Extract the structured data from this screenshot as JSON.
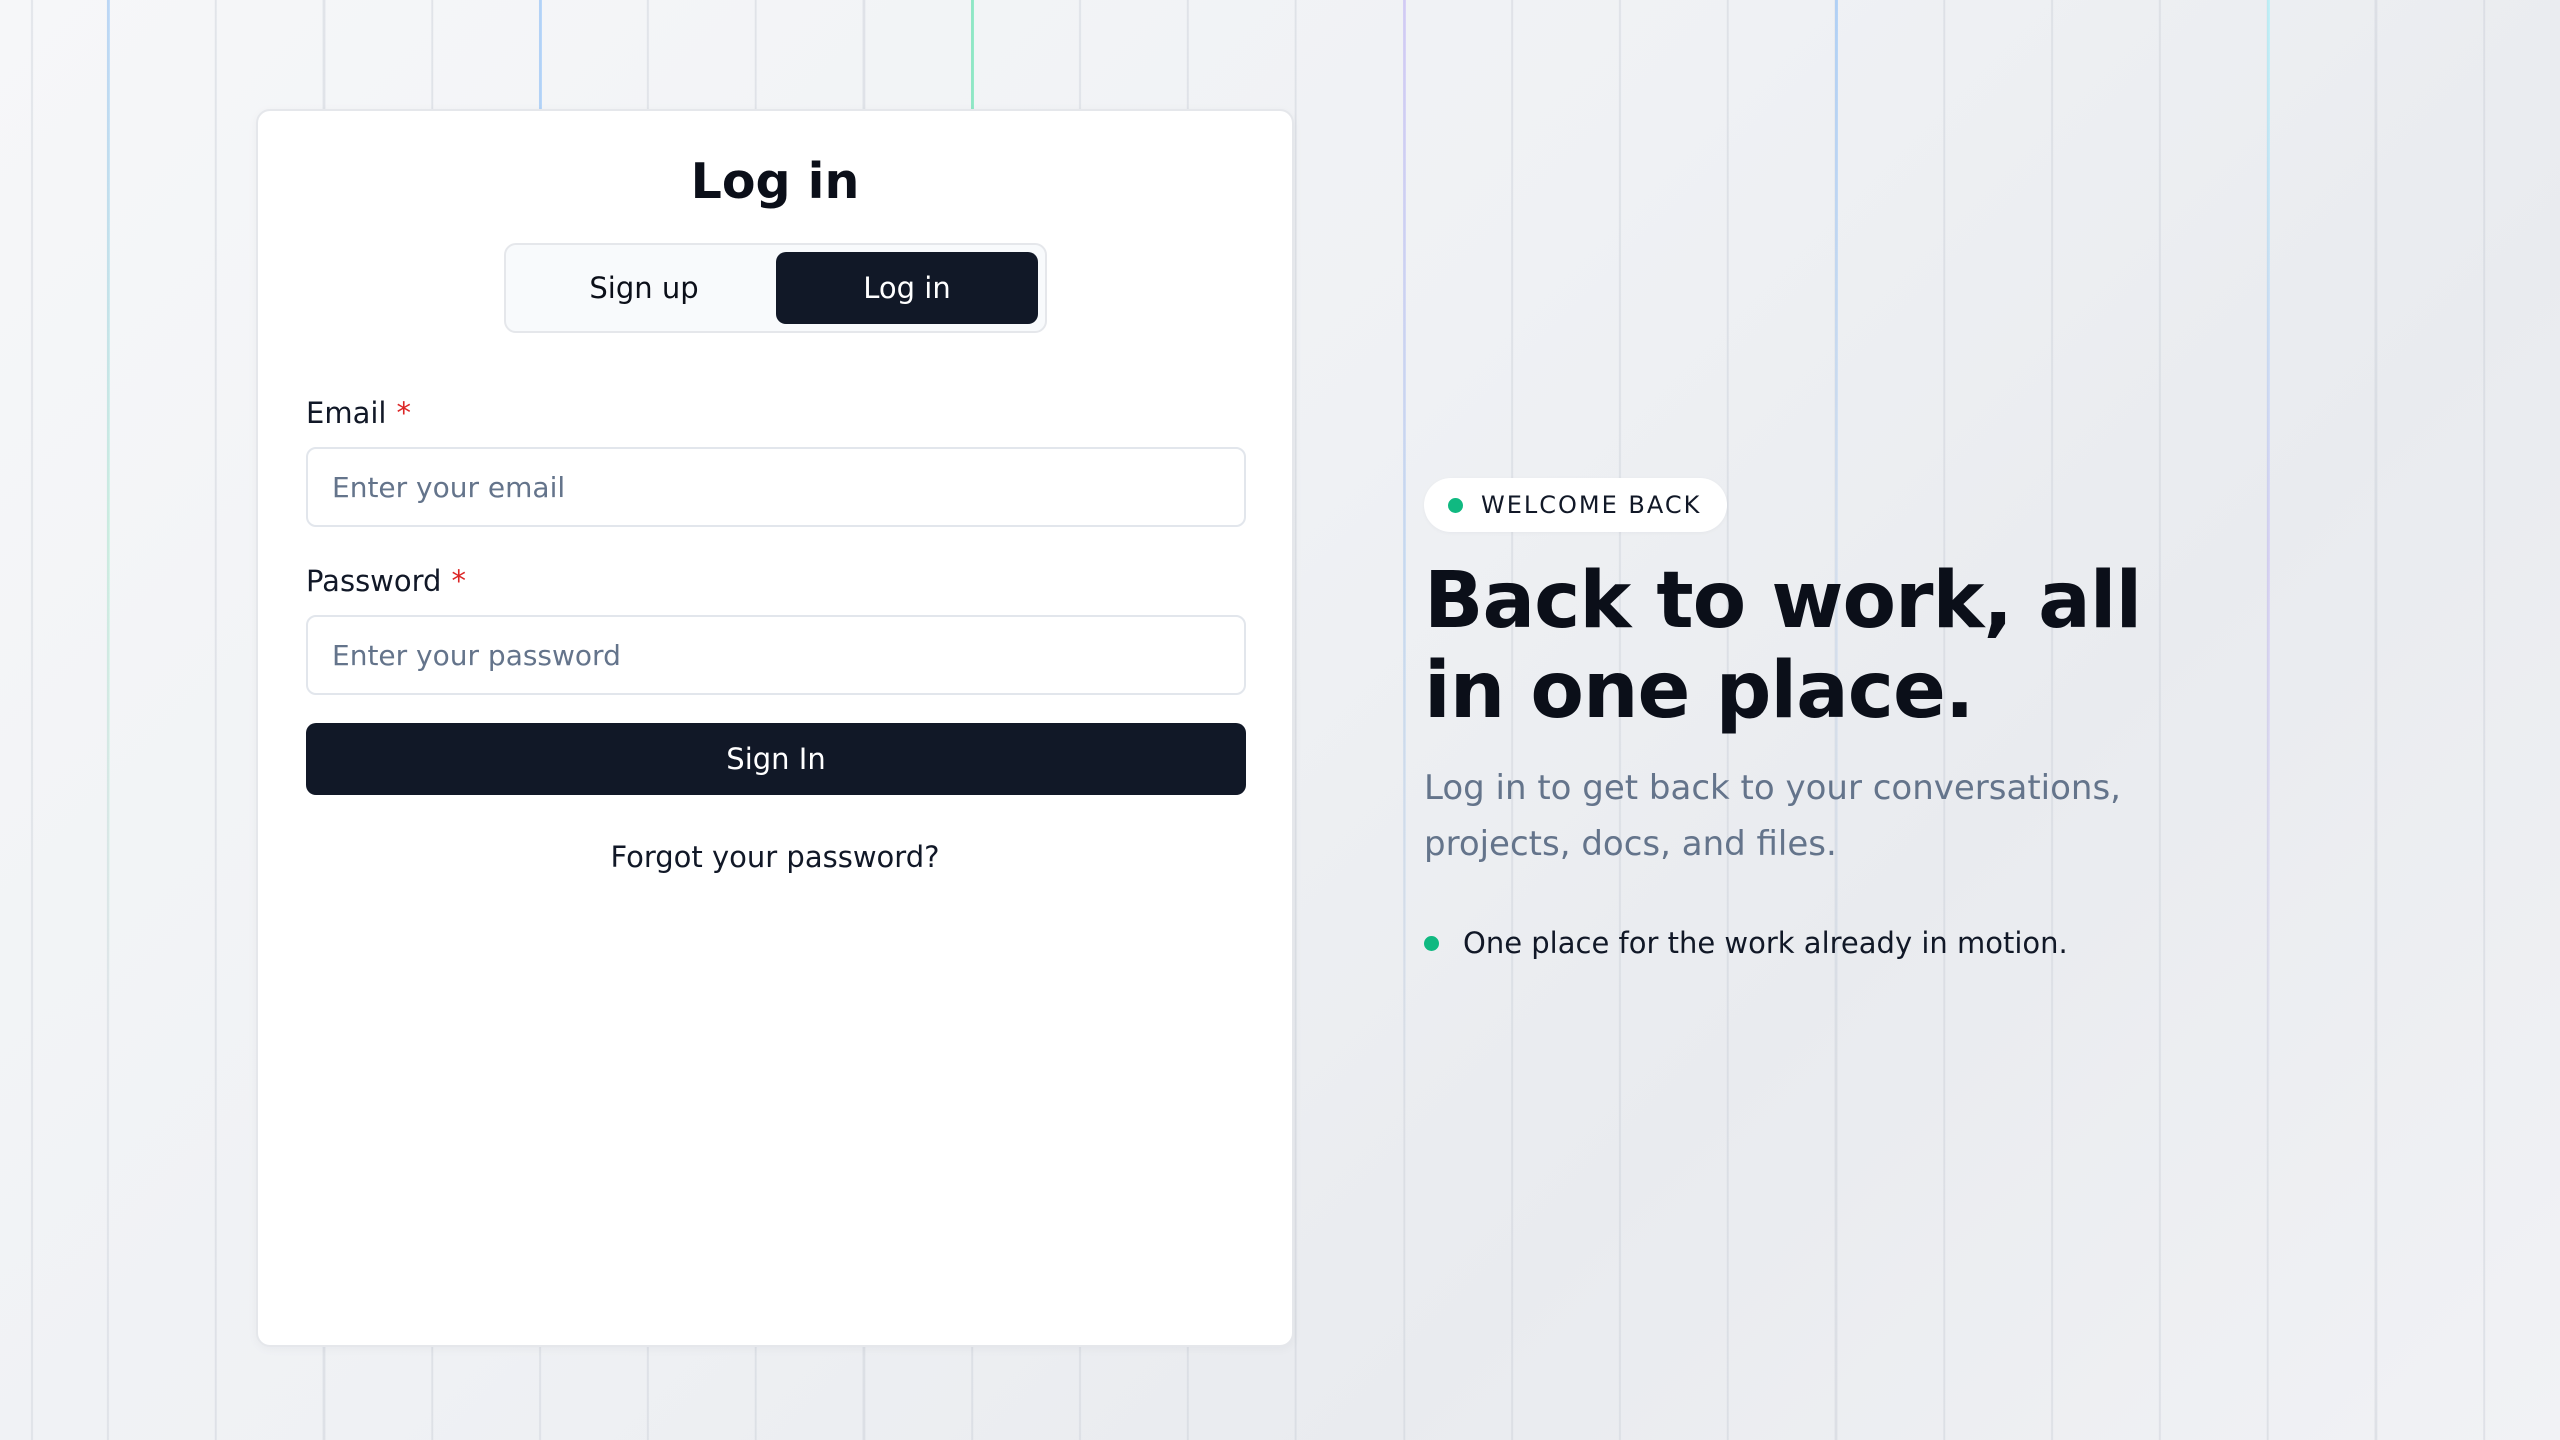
{
  "login_card": {
    "title": "Log in",
    "tabs": [
      {
        "label": "Sign up",
        "active": false
      },
      {
        "label": "Log in",
        "active": true
      }
    ],
    "email": {
      "label": "Email",
      "required_mark": "*",
      "placeholder": "Enter your email",
      "value": ""
    },
    "password": {
      "label": "Password",
      "required_mark": "*",
      "placeholder": "Enter your password",
      "value": ""
    },
    "submit_label": "Sign In",
    "forgot_link": "Forgot your password?"
  },
  "hero": {
    "badge": "WELCOME BACK",
    "title": "Back to work, all in one place.",
    "subtitle": "Log in to get back to your conversations, projects, docs, and files.",
    "bullets": [
      "One place for the work already in motion."
    ]
  },
  "colors": {
    "primary_dark": "#111827",
    "accent_green": "#10b981",
    "required_red": "#dc2626",
    "muted_text": "#64748b",
    "background": "#eff1f4"
  }
}
